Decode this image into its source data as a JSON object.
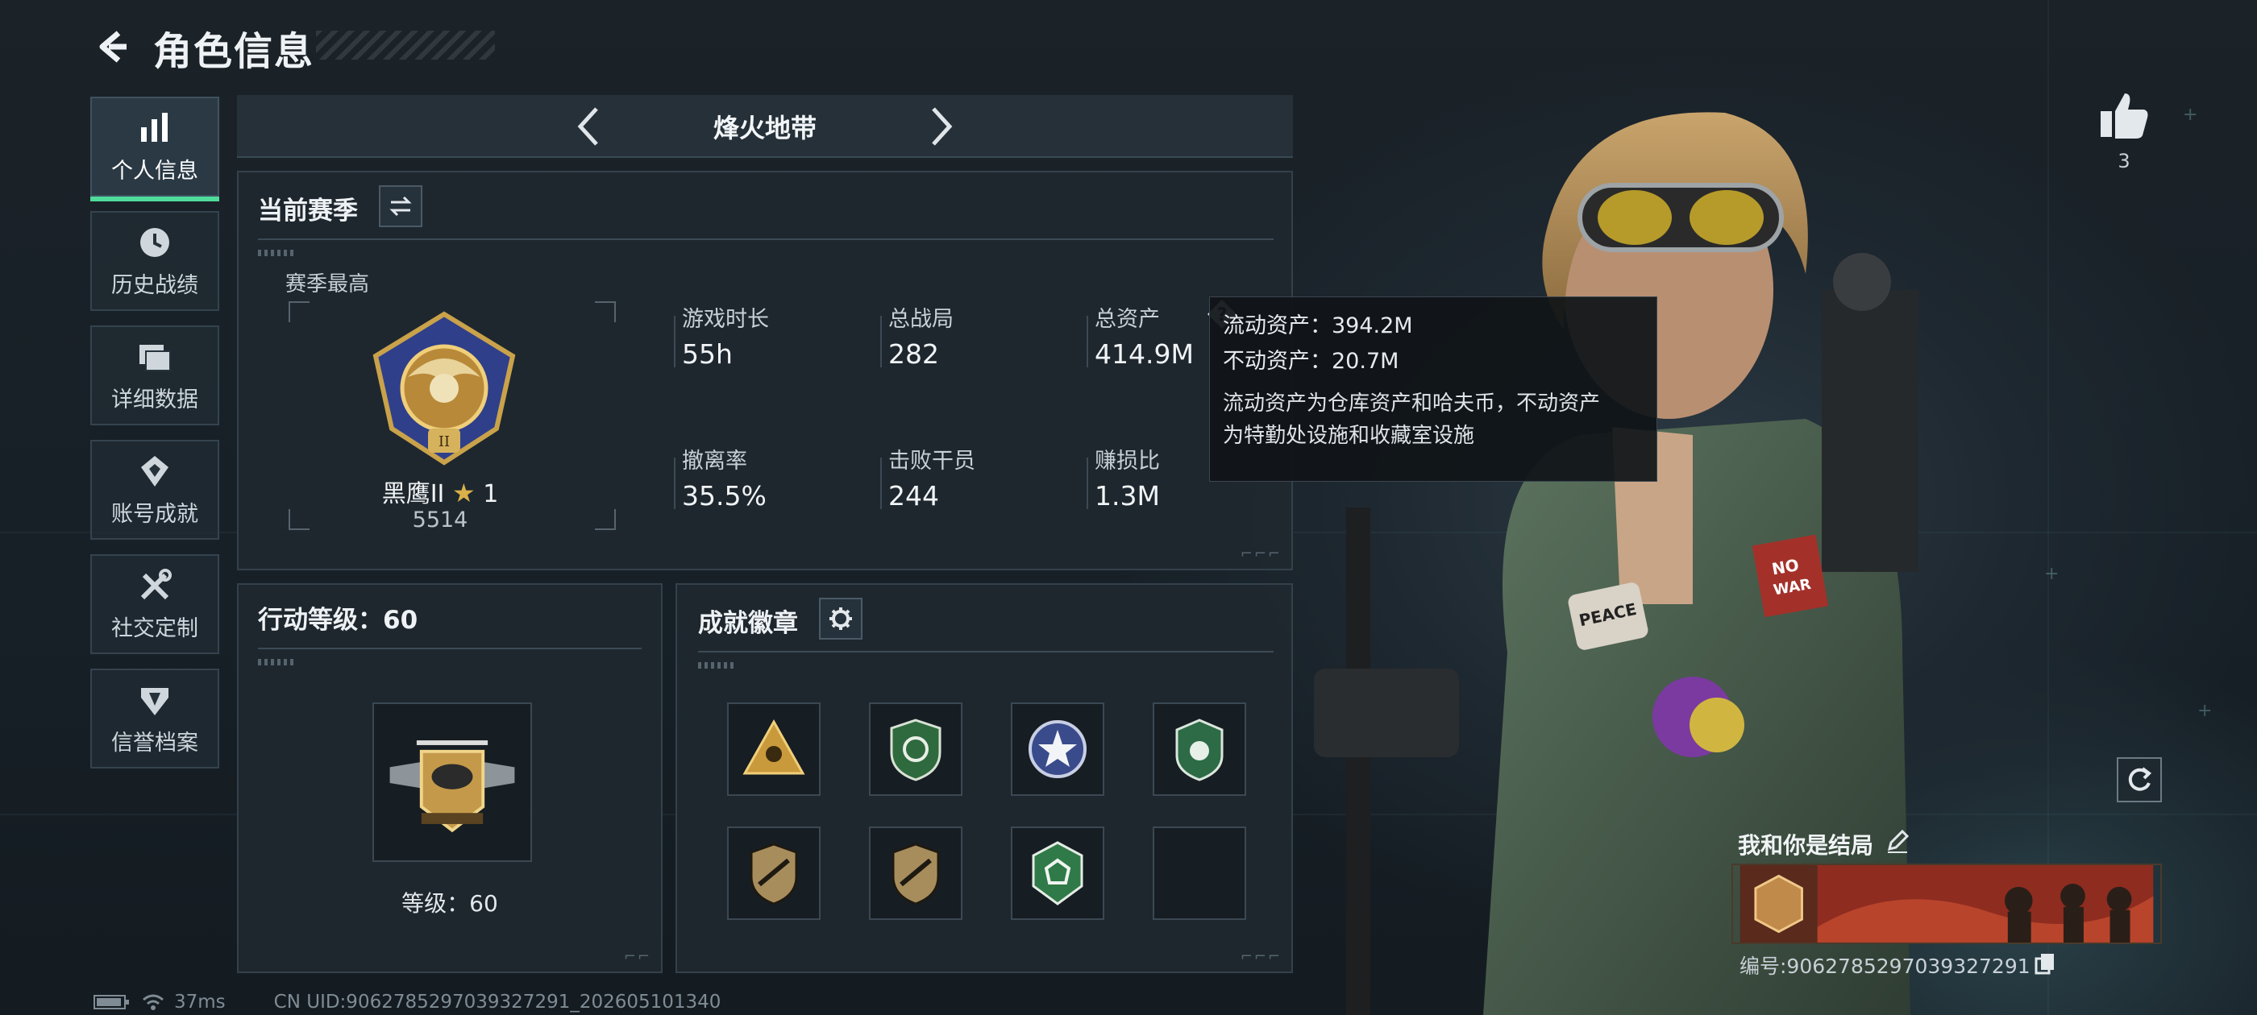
{
  "header": {
    "title": "角色信息"
  },
  "sidebar": {
    "items": [
      {
        "label": "个人信息",
        "icon": "bar-chart-icon",
        "active": true
      },
      {
        "label": "历史战绩",
        "icon": "clock-icon",
        "active": false
      },
      {
        "label": "详细数据",
        "icon": "folders-icon",
        "active": false
      },
      {
        "label": "账号成就",
        "icon": "achievement-icon",
        "active": false
      },
      {
        "label": "社交定制",
        "icon": "tools-icon",
        "active": false
      },
      {
        "label": "信誉档案",
        "icon": "reputation-icon",
        "active": false
      }
    ]
  },
  "mode": {
    "title": "烽火地带"
  },
  "season": {
    "title": "当前赛季",
    "best_label": "赛季最高",
    "rank_name": "黑鹰II",
    "rank_stars": "1",
    "rank_points": "5514",
    "stats": [
      {
        "label": "游戏时长",
        "value": "55h"
      },
      {
        "label": "总战局",
        "value": "282"
      },
      {
        "label": "总资产",
        "value": "414.9M"
      },
      {
        "label": "撤离率",
        "value": "35.5%"
      },
      {
        "label": "击败干员",
        "value": "244"
      },
      {
        "label": "赚损比",
        "value": "1.3M"
      }
    ]
  },
  "tooltip": {
    "liquid": "流动资产：394.2M",
    "fixed": "不动资产：20.7M",
    "desc_line1": "流动资产为仓库资产和哈夫币，不动资产",
    "desc_line2": "为特勤处设施和收藏室设施"
  },
  "action_level": {
    "title": "行动等级：60",
    "level_text": "等级：60"
  },
  "badges": {
    "title": "成就徽章",
    "items": [
      {
        "icon": "triangle-badge-icon"
      },
      {
        "icon": "green-shield-badge-icon"
      },
      {
        "icon": "star-badge-icon"
      },
      {
        "icon": "green-emblem-badge-icon"
      },
      {
        "icon": "rifle-badge-icon"
      },
      {
        "icon": "rifle-badge-icon"
      },
      {
        "icon": "green-hex-badge-icon"
      },
      {
        "icon": "empty-slot"
      }
    ]
  },
  "profile": {
    "likes": "3",
    "card_title": "我和你是结局",
    "card_id": "编号:9062785297039327291"
  },
  "status_bar": {
    "ping": "37ms",
    "uid": "CN UID:9062785297039327291_202605101340"
  },
  "colors": {
    "accent": "#4fdc9a",
    "panel": "#1f282f",
    "background": "#172027"
  }
}
